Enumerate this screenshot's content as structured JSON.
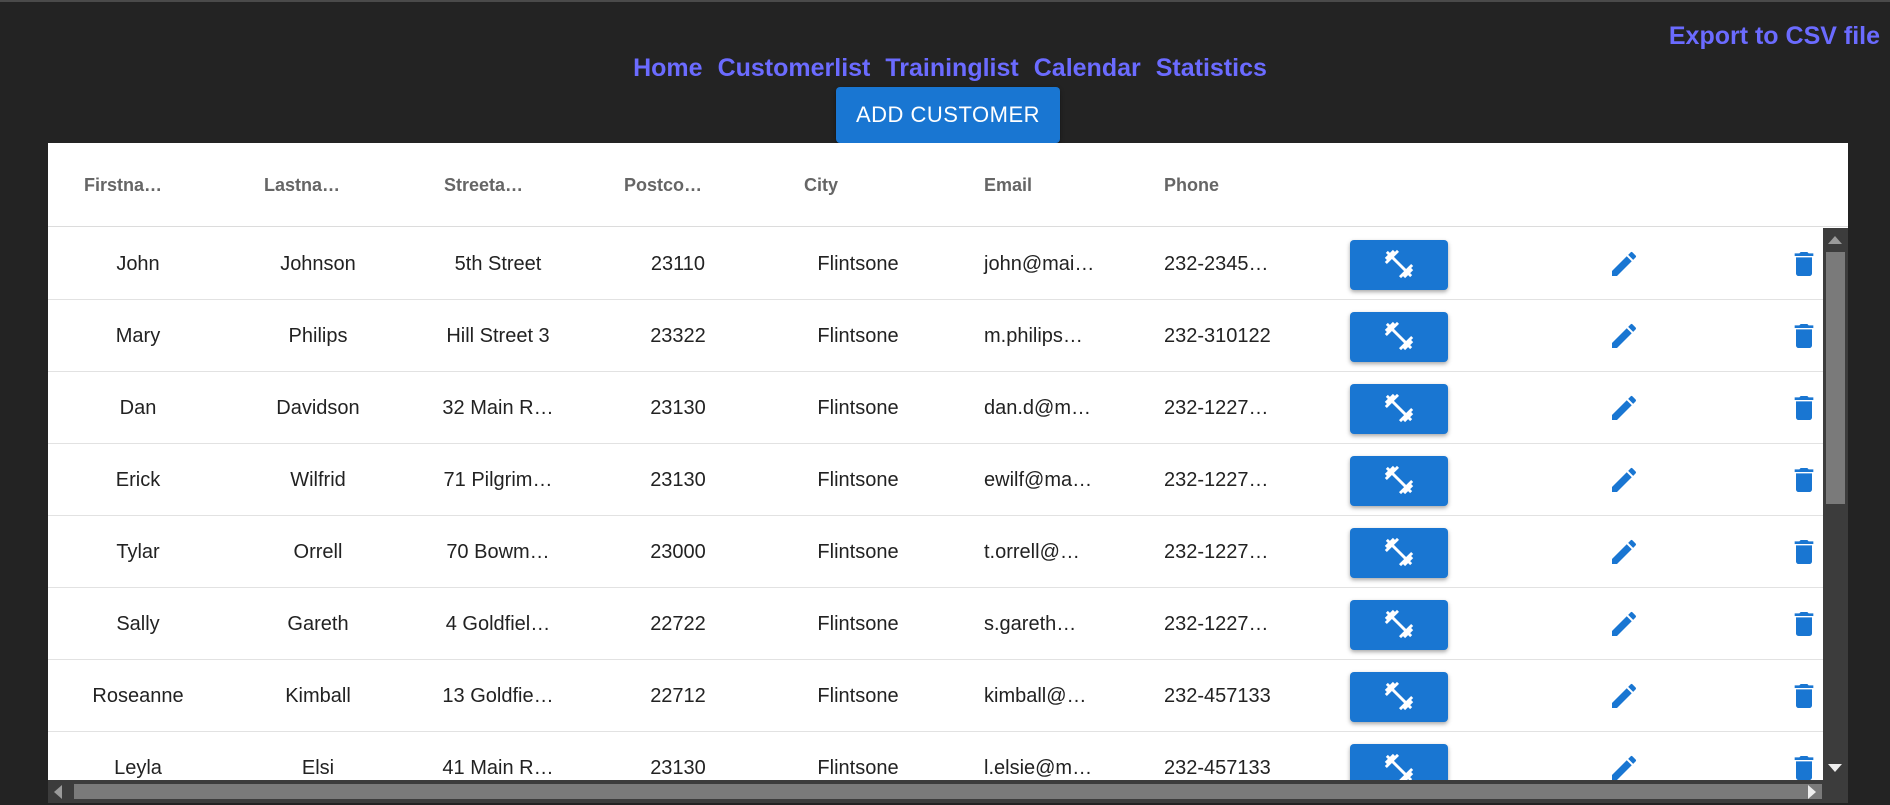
{
  "export_link": "Export to CSV file",
  "nav": [
    "Home",
    "Customerlist",
    "Traininglist",
    "Calendar",
    "Statistics"
  ],
  "add_customer": "ADD CUSTOMER",
  "columns": [
    "Firstna…",
    "Lastna…",
    "Streeta…",
    "Postco…",
    "City",
    "Email",
    "Phone"
  ],
  "rows": [
    {
      "firstname": "John",
      "lastname": "Johnson",
      "street": "5th Street",
      "postcode": "23110",
      "city": "Flintsone",
      "email": "john@mai…",
      "phone": "232-2345…"
    },
    {
      "firstname": "Mary",
      "lastname": "Philips",
      "street": "Hill Street 3",
      "postcode": "23322",
      "city": "Flintsone",
      "email": "m.philips…",
      "phone": "232-310122"
    },
    {
      "firstname": "Dan",
      "lastname": "Davidson",
      "street": "32 Main R…",
      "postcode": "23130",
      "city": "Flintsone",
      "email": "dan.d@m…",
      "phone": "232-1227…"
    },
    {
      "firstname": "Erick",
      "lastname": "Wilfrid",
      "street": "71 Pilgrim…",
      "postcode": "23130",
      "city": "Flintsone",
      "email": "ewilf@ma…",
      "phone": "232-1227…"
    },
    {
      "firstname": "Tylar",
      "lastname": "Orrell",
      "street": "70 Bowm…",
      "postcode": "23000",
      "city": "Flintsone",
      "email": "t.orrell@…",
      "phone": "232-1227…"
    },
    {
      "firstname": "Sally",
      "lastname": "Gareth",
      "street": "4 Goldfiel…",
      "postcode": "22722",
      "city": "Flintsone",
      "email": "s.gareth…",
      "phone": "232-1227…"
    },
    {
      "firstname": "Roseanne",
      "lastname": "Kimball",
      "street": "13 Goldfie…",
      "postcode": "22712",
      "city": "Flintsone",
      "email": "kimball@…",
      "phone": "232-457133"
    },
    {
      "firstname": "Leyla",
      "lastname": "Elsi",
      "street": "41 Main R…",
      "postcode": "23130",
      "city": "Flintsone",
      "email": "l.elsie@m…",
      "phone": "232-457133"
    }
  ],
  "icons": {
    "training": "fitness-icon",
    "edit": "pencil-icon",
    "delete": "trash-icon"
  },
  "colors": {
    "accent": "#1976d2",
    "link": "#6b6bff",
    "background": "#232323"
  }
}
